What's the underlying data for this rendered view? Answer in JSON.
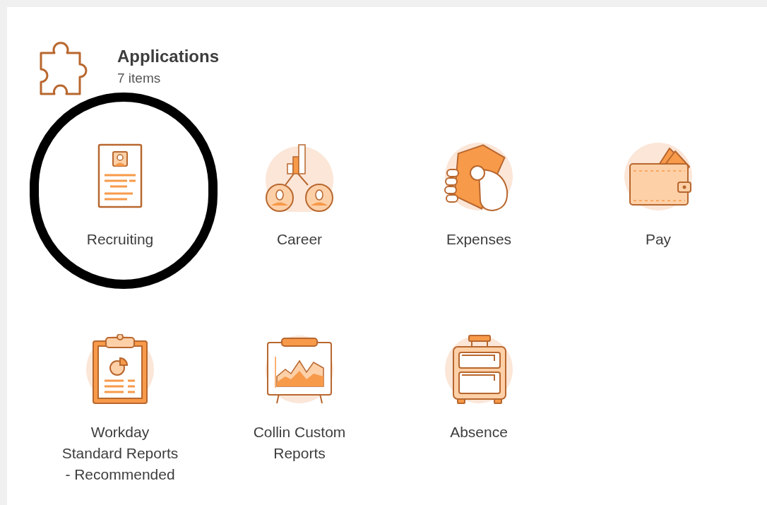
{
  "header": {
    "title": "Applications",
    "count": "7 items"
  },
  "apps": [
    {
      "label": "Recruiting",
      "highlighted": true
    },
    {
      "label": "Career",
      "highlighted": false
    },
    {
      "label": "Expenses",
      "highlighted": false
    },
    {
      "label": "Pay",
      "highlighted": false
    },
    {
      "label": "Workday\nStandard Reports\n- Recommended",
      "highlighted": false
    },
    {
      "label": "Collin Custom\nReports",
      "highlighted": false
    },
    {
      "label": "Absence",
      "highlighted": false
    }
  ]
}
